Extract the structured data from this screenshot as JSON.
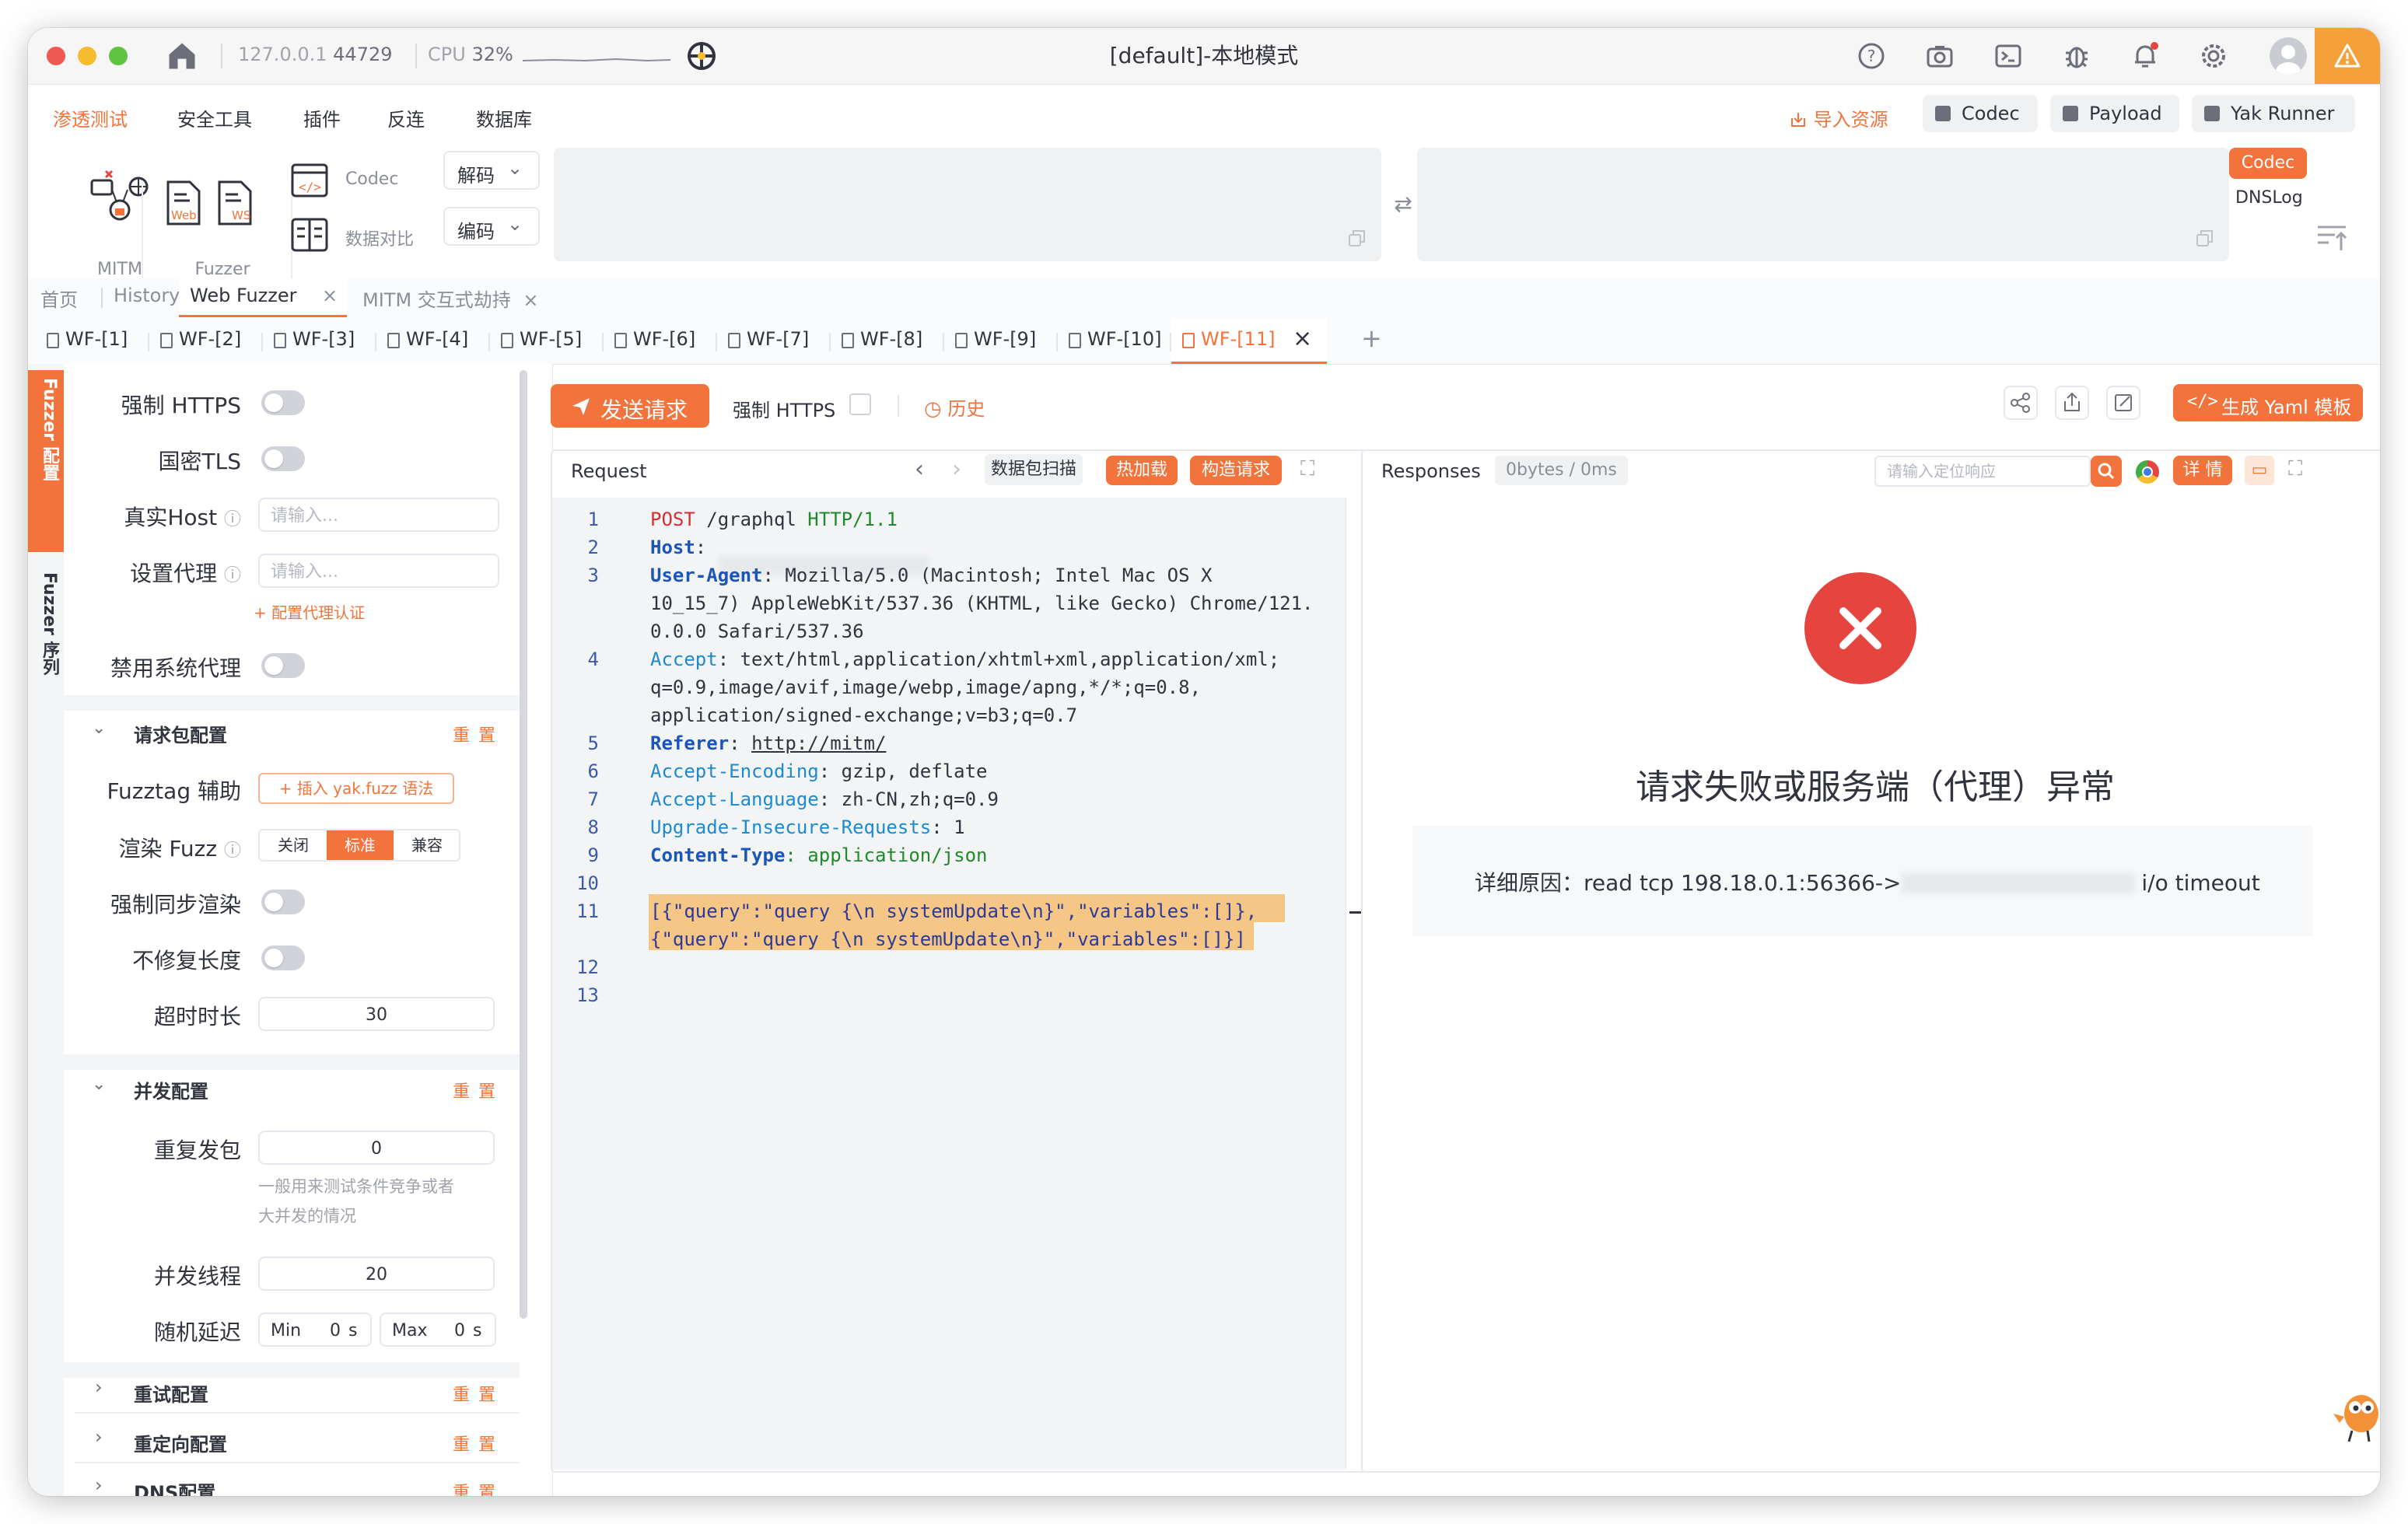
{
  "window": {
    "title": "[default]-本地模式",
    "host": "127.0.0.1",
    "port": "44729",
    "cpu_label": "CPU",
    "cpu_value": "32%"
  },
  "menu": {
    "items": [
      "渗透测试",
      "安全工具",
      "插件",
      "反连",
      "数据库"
    ]
  },
  "top_right": {
    "import": "导入资源",
    "codec": "Codec",
    "payload": "Payload",
    "yak_runner": "Yak Runner"
  },
  "toolbar": {
    "mitm": "MITM",
    "web_tag": "Web",
    "ws_tag": "WS",
    "fuzzer": "Fuzzer",
    "codec": "Codec",
    "compare": "数据对比",
    "decode": "解码",
    "encode": "编码",
    "side_codec": "Codec",
    "side_dnslog": "DNSLog"
  },
  "page_tabs": [
    "首页",
    "History",
    "Web Fuzzer",
    "MITM 交互式劫持"
  ],
  "wf_tabs": [
    "WF-[1]",
    "WF-[2]",
    "WF-[3]",
    "WF-[4]",
    "WF-[5]",
    "WF-[6]",
    "WF-[7]",
    "WF-[8]",
    "WF-[9]",
    "WF-[10]",
    "WF-[11]"
  ],
  "side_tabs": {
    "config": "Fuzzer 配置",
    "sequence": "Fuzzer 序列"
  },
  "config": {
    "force_https": "强制 HTTPS",
    "gm_tls": "国密TLS",
    "real_host": "真实Host",
    "real_host_placeholder": "请输入...",
    "proxy": "设置代理",
    "proxy_placeholder": "请输入...",
    "proxy_auth": "+ 配置代理认证",
    "disable_sys_proxy": "禁用系统代理",
    "packet_section": "请求包配置",
    "reset": "重 置",
    "fuzztag": "Fuzztag 辅助",
    "insert_fuzz": "+ 插入 yak.fuzz 语法",
    "render_fuzz": "渲染 Fuzz",
    "render_options": [
      "关闭",
      "标准",
      "兼容"
    ],
    "sync_render": "强制同步渲染",
    "no_fix_length": "不修复长度",
    "timeout": "超时时长",
    "timeout_value": "30",
    "concurrency_section": "并发配置",
    "repeat": "重复发包",
    "repeat_value": "0",
    "repeat_hint_1": "一般用来测试条件竞争或者",
    "repeat_hint_2": "大并发的情况",
    "threads": "并发线程",
    "threads_value": "20",
    "random_delay": "随机延迟",
    "min_label": "Min",
    "min_value": "0",
    "max_label": "Max",
    "max_value": "0",
    "unit": "s",
    "retry_section": "重试配置",
    "redirect_section": "重定向配置",
    "dns_section": "DNS配置"
  },
  "action_bar": {
    "send": "发送请求",
    "force_https": "强制 HTTPS",
    "history": "历史",
    "gen_yaml": "生成 Yaml 模板"
  },
  "request": {
    "title": "Request",
    "scan": "数据包扫描",
    "hot_load": "热加载",
    "construct": "构造请求",
    "lines": [
      {
        "n": "1",
        "parts": [
          [
            "k",
            "POST"
          ],
          [
            "v",
            " /graphql "
          ],
          [
            "g",
            "HTTP/1.1"
          ]
        ]
      },
      {
        "n": "2",
        "parts": [
          [
            "h",
            "Host"
          ],
          [
            "v",
            ": "
          ]
        ]
      },
      {
        "n": "3",
        "parts": [
          [
            "h",
            "User-Agent"
          ],
          [
            "v",
            ": Mozilla/5.0 (Macintosh; Intel Mac OS X"
          ]
        ]
      },
      {
        "n": "",
        "parts": [
          [
            "v",
            "10_15_7) AppleWebKit/537.36 (KHTML, like Gecko) Chrome/121."
          ]
        ]
      },
      {
        "n": "",
        "parts": [
          [
            "v",
            "0.0.0 Safari/537.36"
          ]
        ]
      },
      {
        "n": "4",
        "parts": [
          [
            "hl",
            "Accept"
          ],
          [
            "v",
            ": text/html,application/xhtml+xml,application/xml;"
          ]
        ]
      },
      {
        "n": "",
        "parts": [
          [
            "v",
            "q=0.9,image/avif,image/webp,image/apng,*/*;q=0.8,"
          ]
        ]
      },
      {
        "n": "",
        "parts": [
          [
            "v",
            "application/signed-exchange;v=b3;q=0.7"
          ]
        ]
      },
      {
        "n": "5",
        "parts": [
          [
            "h",
            "Referer"
          ],
          [
            "v",
            ": "
          ],
          [
            "u",
            "http://mitm/"
          ]
        ]
      },
      {
        "n": "6",
        "parts": [
          [
            "hl",
            "Accept-Encoding"
          ],
          [
            "v",
            ": gzip, deflate"
          ]
        ]
      },
      {
        "n": "7",
        "parts": [
          [
            "hl",
            "Accept-Language"
          ],
          [
            "v",
            ": zh-CN,zh;q=0.9"
          ]
        ]
      },
      {
        "n": "8",
        "parts": [
          [
            "hl",
            "Upgrade-Insecure-Requests"
          ],
          [
            "v",
            ": 1"
          ]
        ]
      },
      {
        "n": "9",
        "parts": [
          [
            "h",
            "Content-Type"
          ],
          [
            "g",
            ": application/json"
          ]
        ]
      },
      {
        "n": "10",
        "parts": []
      },
      {
        "n": "11",
        "parts": [
          [
            "b",
            "[{\"query\":\"query {\\n systemUpdate\\n}\",\"variables\":[]},"
          ]
        ]
      },
      {
        "n": "",
        "parts": [
          [
            "b",
            "{\"query\":\"query {\\n systemUpdate\\n}\",\"variables\":[]}]"
          ]
        ]
      },
      {
        "n": "12",
        "parts": []
      },
      {
        "n": "13",
        "parts": []
      }
    ]
  },
  "response": {
    "title": "Responses",
    "stats": "0bytes / 0ms",
    "search_placeholder": "请输入定位响应",
    "detail": "详 情",
    "error_title": "请求失败或服务端（代理）异常",
    "reason_label": "详细原因：",
    "reason_text": "read tcp 198.18.0.1:56366->",
    "reason_tail": "i/o timeout"
  },
  "colors": {
    "accent": "#f2733b",
    "error": "#e6443f",
    "code_bg": "#f3f4f6"
  }
}
